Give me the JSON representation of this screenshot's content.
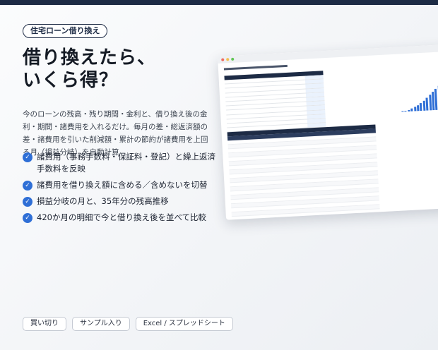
{
  "badge": "住宅ローン借り換え",
  "headline": {
    "line1": "借り換えたら、",
    "line2": "いくら得？"
  },
  "description": "今のローンの残高・残り期間・金利と、借り換え後の金利・期間・諸費用を入れるだけ。毎月の差・総返済額の差・諸費用を引いた削減額・累計の節約が諸費用を上回る月（損益分岐）を自動計算",
  "features": [
    "諸費用（事務手数料・保証料・登記）と繰上返済手数料を反映",
    "諸費用を借り換え額に含める／含めないを切替",
    "損益分岐の月と、35年分の残高推移",
    "420か月の明細で今と借り換え後を並べて比較"
  ],
  "tags": [
    "買い切り",
    "サンプル入り",
    "Excel / スプレッドシート"
  ],
  "colors": {
    "accent": "#2f6fd6",
    "navy": "#1d2b45",
    "check": "#2f6fd6"
  },
  "icons": {
    "feature_bullet": "check-circle-icon"
  }
}
